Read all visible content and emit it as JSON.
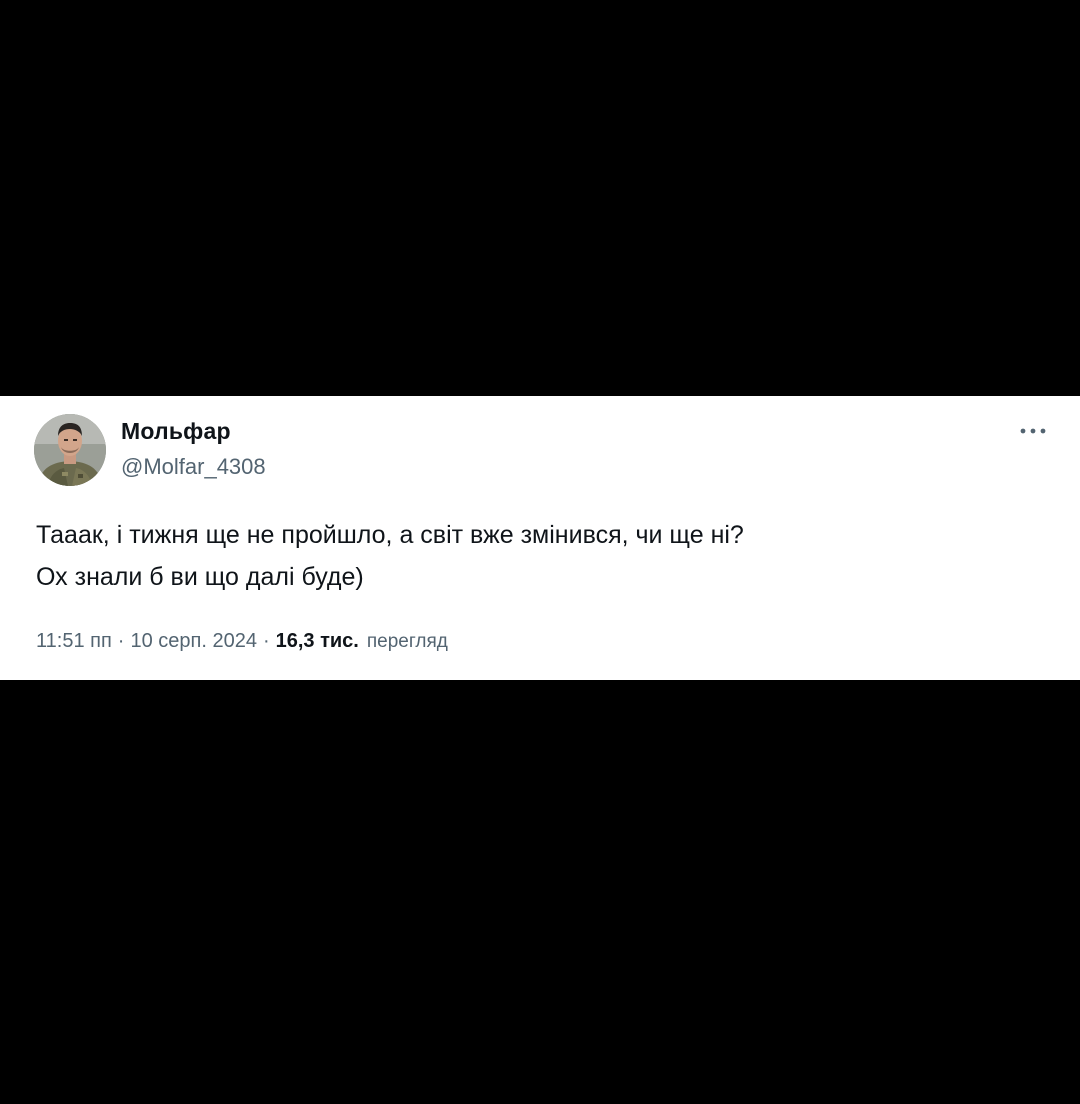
{
  "tweet": {
    "display_name": "Мольфар",
    "handle": "@Molfar_4308",
    "text_lines": [
      "Тааак, і тижня ще не пройшло, а світ вже змінився, чи ще ні?",
      "Ох знали б ви що далі буде)"
    ],
    "time": "11:51 пп",
    "separator": "·",
    "date": "10 серп. 2024",
    "views_count": "16,3 тис.",
    "views_label": "перегляд",
    "more_icon": "more-horizontal-icon",
    "avatar_icon": "profile-photo"
  },
  "colors": {
    "background": "#000000",
    "card": "#ffffff",
    "primary_text": "#0f1419",
    "secondary_text": "#536471"
  }
}
